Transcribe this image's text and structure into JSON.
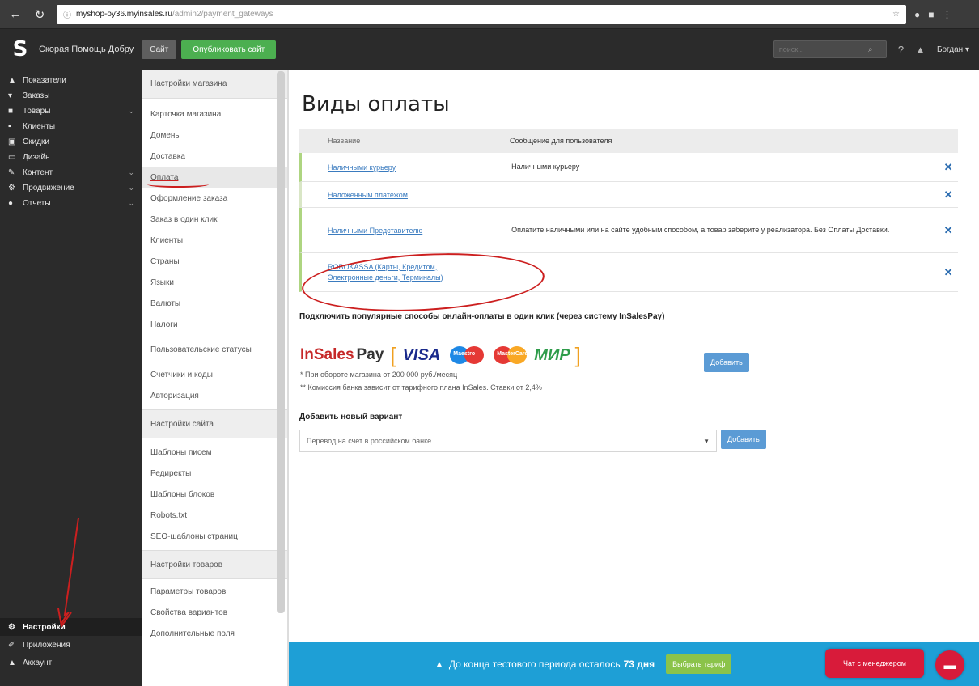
{
  "browser": {
    "url_host": "myshop-oy36.myinsales.ru",
    "url_path": "/admin2/payment_gateways"
  },
  "header": {
    "shop_name": "Скорая Помощь Добру",
    "site_label": "Сайт",
    "publish_label": "Опубликовать сайт",
    "search_placeholder": "поиск...",
    "user": "Богдан"
  },
  "sidebar": {
    "items": [
      {
        "label": "Показатели"
      },
      {
        "label": "Заказы"
      },
      {
        "label": "Товары"
      },
      {
        "label": "Клиенты"
      },
      {
        "label": "Скидки"
      },
      {
        "label": "Дизайн"
      },
      {
        "label": "Контент"
      },
      {
        "label": "Продвижение"
      },
      {
        "label": "Отчеты"
      }
    ],
    "bottom": [
      {
        "label": "Настройки"
      },
      {
        "label": "Приложения"
      },
      {
        "label": "Аккаунт"
      }
    ]
  },
  "submenu": {
    "store_header": "Настройки магазина",
    "store_items": [
      "Карточка магазина",
      "Домены",
      "Доставка",
      "Оплата",
      "Оформление заказа",
      "Заказ в один клик",
      "Клиенты",
      "Страны",
      "Языки",
      "Валюты",
      "Налоги",
      "Пользовательские статусы",
      "Счетчики и коды",
      "Авторизация"
    ],
    "site_header": "Настройки сайта",
    "site_items": [
      "Шаблоны писем",
      "Редиректы",
      "Шаблоны блоков",
      "Robots.txt",
      "SEO-шаблоны страниц"
    ],
    "products_header": "Настройки товаров",
    "products_items": [
      "Параметры товаров",
      "Свойства вариантов",
      "Дополнительные поля"
    ]
  },
  "main": {
    "title": "Виды оплаты",
    "col_name": "Название",
    "col_message": "Сообщение для пользователя",
    "rows": [
      {
        "name": "Наличными курьеру",
        "message": "Наличными курьеру"
      },
      {
        "name": "Наложенным платежом",
        "message": ""
      },
      {
        "name": "Наличными Представителю",
        "message": "Оплатите наличными или на сайте удобным способом, а товар заберите у реализатора. Без Оплаты Доставки."
      },
      {
        "name": "ROBOKASSA (Карты, Кредитом, Электронные деньги, Терминалы)",
        "message": ""
      }
    ],
    "insales_note": "Подключить популярные способы онлайн-оплаты в один клик (через систему InSalesPay)",
    "brand_insales": "InSales",
    "brand_pay": "Pay",
    "brand_visa": "VISA",
    "brand_maestro": "Maestro",
    "brand_mastercard": "MasterCard",
    "brand_mir": "МИР",
    "add_button_1": "Добавить",
    "footnote_1": "* При обороте магазина от 200 000 руб./месяц",
    "footnote_2": "** Комиссия банка зависит от тарифного плана InSales. Ставки от 2,4%",
    "add_variant_title": "Добавить новый вариант",
    "select_value": "Перевод на счет в российском банке",
    "add_button_2": "Добавить"
  },
  "trial": {
    "text_before": "До конца тестового периода осталось",
    "days": "73 дня",
    "tariff_button": "Выбрать тариф",
    "chat_button": "Чат с менеджером"
  },
  "colors": {
    "accent": "#5b9bd5",
    "trial_bar": "#1e9fd6",
    "chat": "#d81b3a",
    "annotation": "#cc1f1f"
  }
}
